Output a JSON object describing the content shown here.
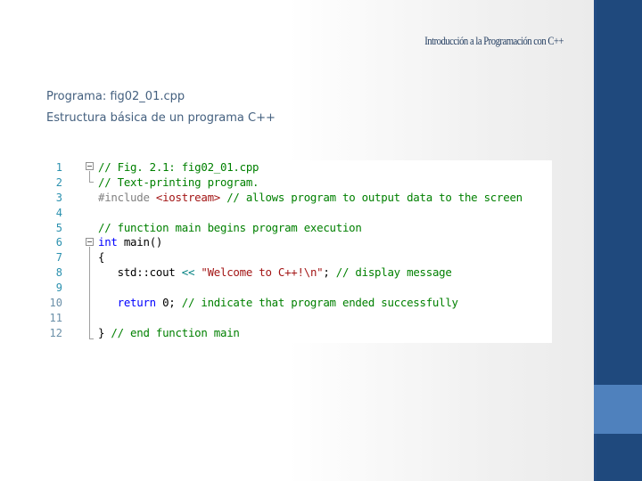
{
  "slide": {
    "title": "Introducción a la Programación con C++",
    "subtitle_lines": [
      "Programa: fig02_01.cpp",
      "Estructura básica de un programa C++"
    ]
  },
  "code": {
    "line_numbers": [
      "1",
      "2",
      "3",
      "4",
      "5",
      "6",
      "7",
      "8",
      "9",
      "10",
      "11",
      "12"
    ],
    "lines": [
      [
        {
          "t": "cm",
          "v": "// Fig. 2.1: fig02_01.cpp"
        }
      ],
      [
        {
          "t": "cm",
          "v": "// Text-printing program."
        }
      ],
      [
        {
          "t": "pp",
          "v": "#include "
        },
        {
          "t": "inc",
          "v": "<iostream>"
        },
        {
          "t": "cm",
          "v": " // allows program to output data to the screen"
        }
      ],
      [],
      [
        {
          "t": "cm",
          "v": "// function main begins program execution"
        }
      ],
      [
        {
          "t": "kw",
          "v": "int"
        },
        {
          "t": "plain",
          "v": " main()"
        }
      ],
      [
        {
          "t": "plain",
          "v": "{"
        }
      ],
      [
        {
          "t": "plain",
          "v": "   std::cout "
        },
        {
          "t": "op",
          "v": "<<"
        },
        {
          "t": "plain",
          "v": " "
        },
        {
          "t": "str",
          "v": "\"Welcome to C++!\\n\""
        },
        {
          "t": "plain",
          "v": "; "
        },
        {
          "t": "cm",
          "v": "// display message"
        }
      ],
      [],
      [
        {
          "t": "kw",
          "v": "   return"
        },
        {
          "t": "plain",
          "v": " 0; "
        },
        {
          "t": "cm",
          "v": "// indicate that program ended successfully"
        }
      ],
      [],
      [
        {
          "t": "plain",
          "v": "} "
        },
        {
          "t": "cm",
          "v": "// end function main"
        }
      ]
    ]
  },
  "icons": {
    "fold_markers": [
      "collapse-icon",
      "collapse-icon"
    ]
  },
  "colors": {
    "sidebar": "#1f497d",
    "sidebar_accent": "#4f81bd",
    "subtitle": "#44607f",
    "title": "#1f3a5e",
    "comment": "#008000",
    "keyword": "#0000ff",
    "string": "#a31515",
    "line_number": "#2b91af"
  }
}
